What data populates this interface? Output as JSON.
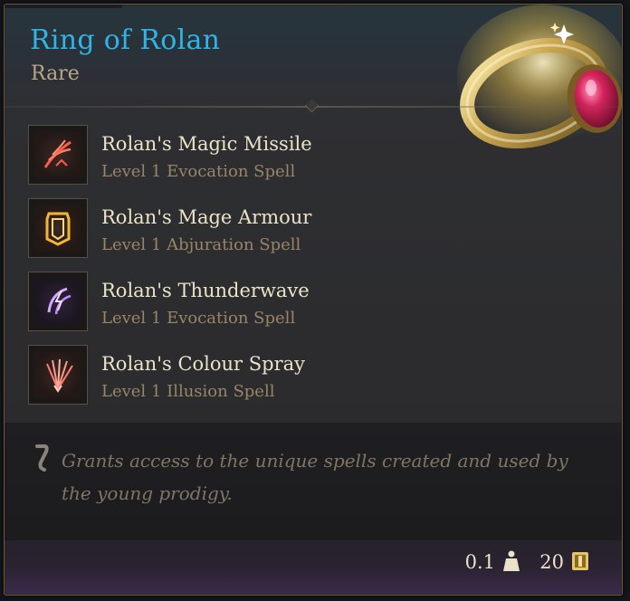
{
  "item": {
    "name": "Ring of Rolan",
    "rarity": "Rare",
    "image": "ring-icon"
  },
  "colors": {
    "title": "#2fb4e8",
    "rarity": "#b8a68b",
    "spell_name": "#ece2c9",
    "spell_level": "#9a8468",
    "description": "#807565"
  },
  "spells": [
    {
      "name": "Rolan's Magic Missile",
      "level": "Level 1 Evocation Spell",
      "icon": "magic-missile-icon"
    },
    {
      "name": "Rolan's Mage Armour",
      "level": "Level 1 Abjuration Spell",
      "icon": "mage-armour-icon"
    },
    {
      "name": "Rolan's Thunderwave",
      "level": "Level 1 Evocation Spell",
      "icon": "thunderwave-icon"
    },
    {
      "name": "Rolan's Colour Spray",
      "level": "Level 1 Illusion Spell",
      "icon": "colour-spray-icon"
    }
  ],
  "description": {
    "text": "Grants access to the unique spells created and used by the young prodigy.",
    "icon": "scroll-quill-icon"
  },
  "footer": {
    "weight": "0.1",
    "weight_icon": "weight-icon",
    "value": "20",
    "value_icon": "gold-coin-icon"
  }
}
